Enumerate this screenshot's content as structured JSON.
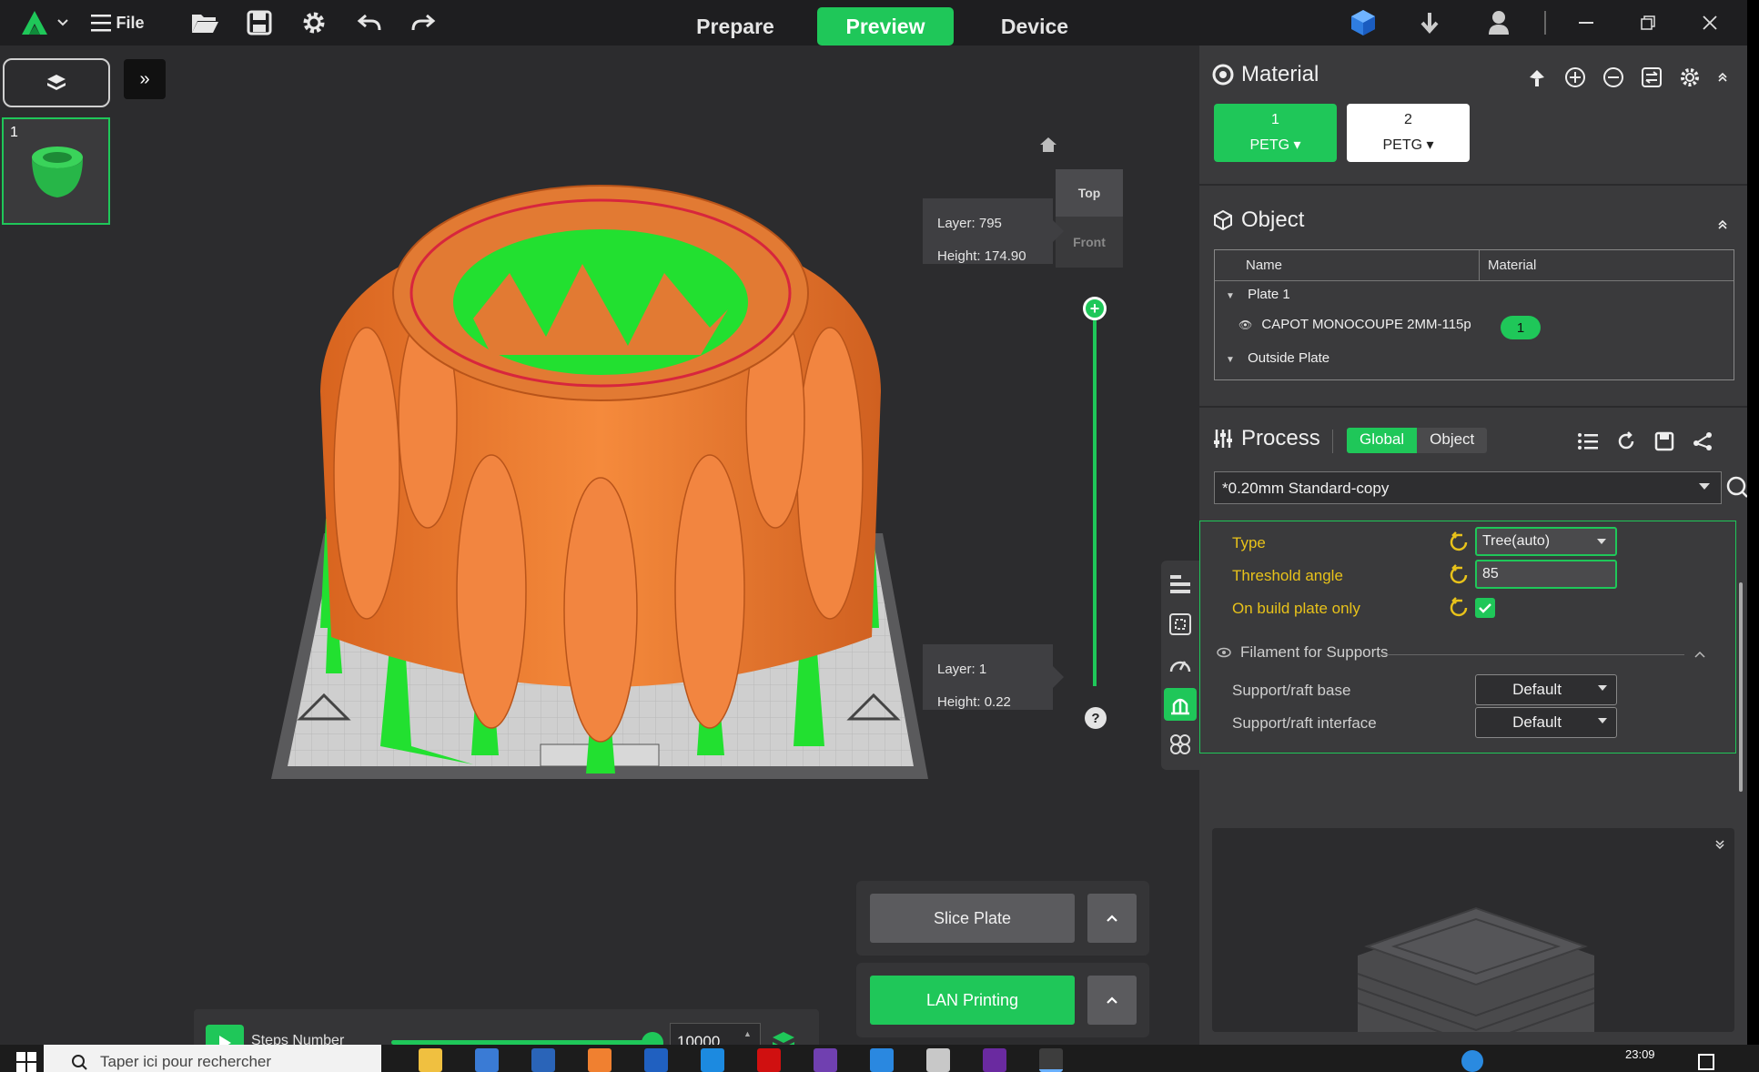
{
  "titlebar": {
    "file_label": "File",
    "tabs": [
      {
        "label": "Prepare",
        "active": false
      },
      {
        "label": "Preview",
        "active": true
      },
      {
        "label": "Device",
        "active": false
      }
    ]
  },
  "plates": [
    {
      "number": "1"
    }
  ],
  "layer_slider": {
    "top": {
      "layer": "Layer: 795",
      "height": "Height: 174.90"
    },
    "bottom": {
      "layer": "Layer: 1",
      "height": "Height: 0.22"
    }
  },
  "view_cube": {
    "top": "Top",
    "front": "Front"
  },
  "help_label": "?",
  "steps": {
    "label": "Steps Number",
    "value": "10000",
    "progress": 1.0
  },
  "actions": {
    "slice_label": "Slice Plate",
    "lan_label": "LAN Printing"
  },
  "material": {
    "title": "Material",
    "slots": [
      {
        "index": "1",
        "type": "PETG ▾",
        "color": "#1fc759"
      },
      {
        "index": "2",
        "type": "PETG ▾",
        "color": "#ffffff"
      }
    ]
  },
  "object": {
    "title": "Object",
    "columns": {
      "name": "Name",
      "material": "Material"
    },
    "plate": "Plate 1",
    "item_name": "CAPOT MONOCOUPE 2MM-115p",
    "item_material": "1",
    "outside": "Outside Plate"
  },
  "process": {
    "title": "Process",
    "seg_global": "Global",
    "seg_object": "Object",
    "preset": "*0.20mm Standard-copy",
    "settings": {
      "type_label": "Type",
      "type_value": "Tree(auto)",
      "threshold_label": "Threshold angle",
      "threshold_value": "85",
      "buildplate_label": "On build plate only",
      "buildplate_checked": true
    },
    "filament": {
      "header": "Filament for Supports",
      "base_label": "Support/raft base",
      "base_value": "Default",
      "interface_label": "Support/raft interface",
      "interface_value": "Default"
    }
  },
  "taskbar": {
    "search_placeholder": "Taper ici pour rechercher",
    "time": "23:09"
  },
  "colors": {
    "accent": "#1fc759",
    "model": "#f07a2c",
    "support": "#22e030",
    "changed": "#e8c21a"
  }
}
